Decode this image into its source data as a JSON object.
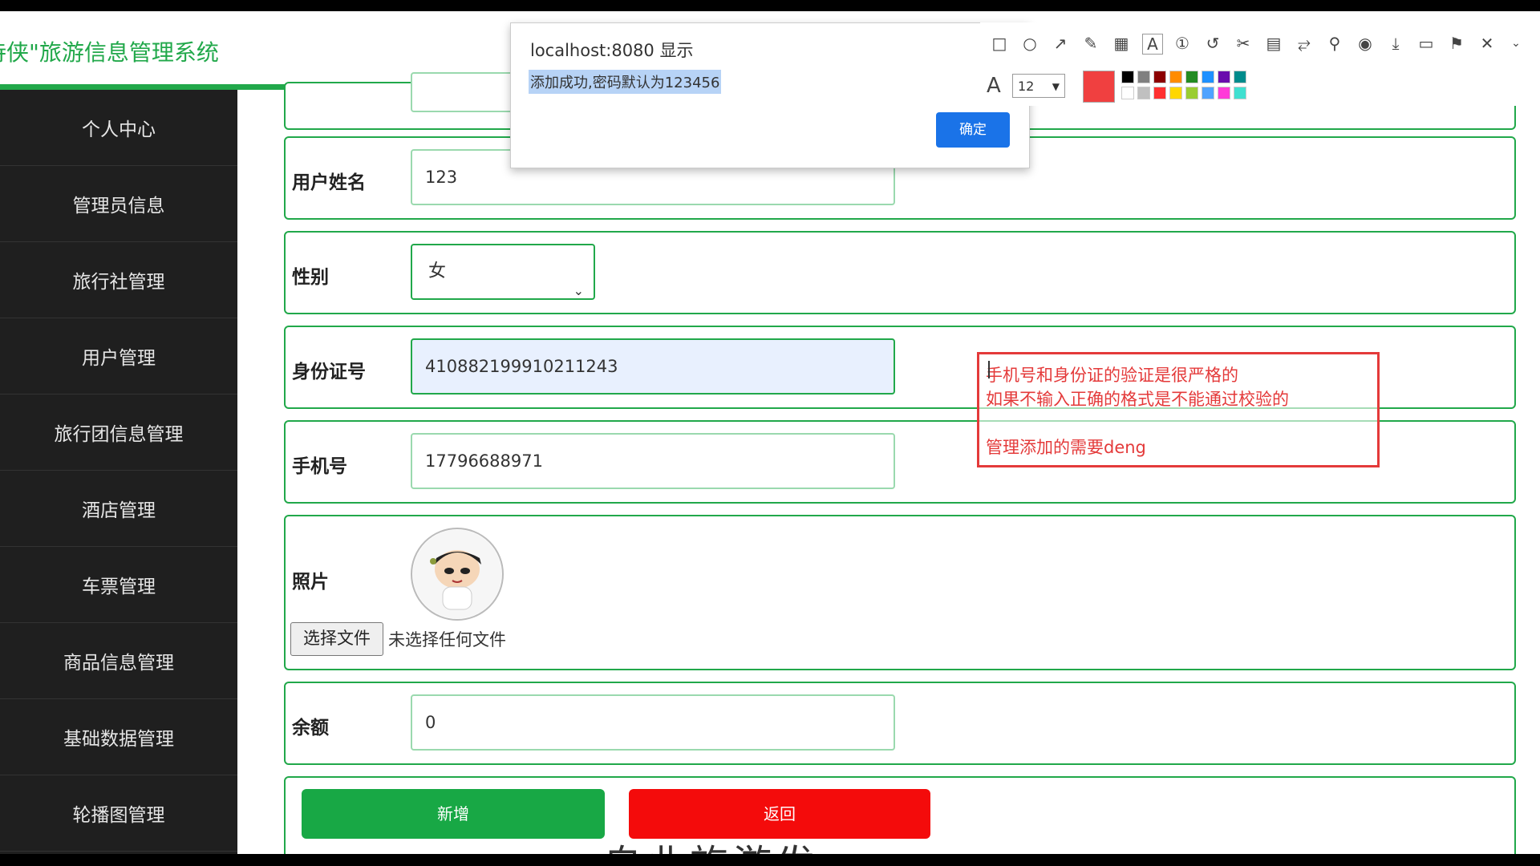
{
  "app": {
    "title": "侍侠\"旅游信息管理系统"
  },
  "sidebar": {
    "items": [
      {
        "label": "个人中心"
      },
      {
        "label": "管理员信息"
      },
      {
        "label": "旅行社管理"
      },
      {
        "label": "用户管理"
      },
      {
        "label": "旅行团信息管理"
      },
      {
        "label": "酒店管理"
      },
      {
        "label": "车票管理"
      },
      {
        "label": "商品信息管理"
      },
      {
        "label": "基础数据管理"
      },
      {
        "label": "轮播图管理"
      }
    ]
  },
  "form": {
    "name_label": "用户姓名",
    "name_value": "123",
    "gender_label": "性别",
    "gender_value": "女",
    "id_label": "身份证号",
    "id_value": "410882199910211243",
    "phone_label": "手机号",
    "phone_value": "17796688971",
    "photo_label": "照片",
    "file_button": "选择文件",
    "file_status": "未选择任何文件",
    "balance_label": "余额",
    "balance_value": "0",
    "add_button": "新增",
    "back_button": "返回"
  },
  "dialog": {
    "title": "localhost:8080 显示",
    "message": "添加成功,密码默认为123456",
    "ok": "确定"
  },
  "annotation": {
    "line1": "手机号和身份证的验证是很严格的",
    "line2": "如果不输入正确的格式是不能通过校验的",
    "line3": "管理添加的需要deng"
  },
  "toolbar": {
    "font_size": "12",
    "icons": [
      "rectangle-icon",
      "circle-icon",
      "arrow-icon",
      "pencil-icon",
      "mosaic-icon",
      "text-icon",
      "number-icon",
      "undo-icon",
      "cut-icon",
      "translate-icon",
      "expand-icon",
      "pin-icon",
      "record-icon",
      "download-icon",
      "save-icon",
      "bookmark-icon",
      "close-icon",
      "chevron-down-icon"
    ],
    "current_color": "#f04040",
    "colors_top": [
      "#000000",
      "#808080",
      "#8b0000",
      "#ff8c00",
      "#228b22",
      "#1e90ff",
      "#6a0dad",
      "#008b8b"
    ],
    "colors_bottom": [
      "#ffffff",
      "#c0c0c0",
      "#ff3030",
      "#ffd700",
      "#9acd32",
      "#4fa3ff",
      "#ff3ad8",
      "#40e0d0"
    ]
  },
  "background_text": "自业旅游发"
}
